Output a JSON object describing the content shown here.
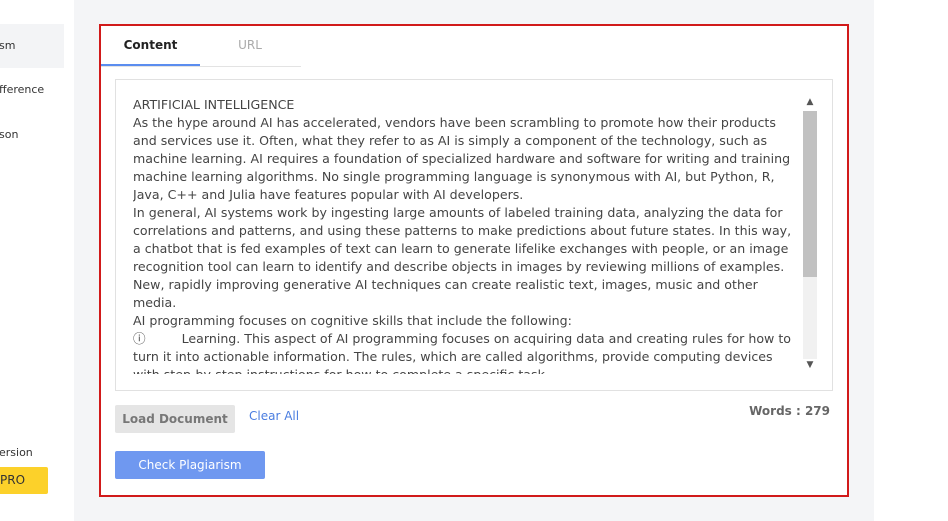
{
  "sidebar": {
    "items": [
      {
        "label": "sm"
      },
      {
        "label": "fference"
      },
      {
        "label": "son"
      }
    ],
    "footer_text": "ersion",
    "pro_label": "PRO"
  },
  "tabs": [
    {
      "label": "Content"
    },
    {
      "label": "URL"
    }
  ],
  "editor": {
    "text": "ARTIFICIAL INTELLIGENCE\nAs the hype around AI has accelerated, vendors have been scrambling to promote how their products and services use it. Often, what they refer to as AI is simply a component of the technology, such as machine learning. AI requires a foundation of specialized hardware and software for writing and training machine learning algorithms. No single programming language is synonymous with AI, but Python, R, Java, C++ and Julia have features popular with AI developers.\nIn general, AI systems work by ingesting large amounts of labeled training data, analyzing the data for correlations and patterns, and using these patterns to make predictions about future states. In this way, a chatbot that is fed examples of text can learn to generate lifelike exchanges with people, or an image recognition tool can learn to identify and describe objects in images by reviewing millions of examples. New, rapidly improving generative AI techniques can create realistic text, images, music and other media.\nAI programming focuses on cognitive skills that include the following:\nⓘ         Learning. This aspect of AI programming focuses on acquiring data and creating rules for how to turn it into actionable information. The rules, which are called algorithms, provide computing devices with step-by-step instructions for how to complete a specific task.\nⓘ         Reasoning. This aspect of AI programming focuses on choosing the right algorithm to reach a desired outcome."
  },
  "actions": {
    "load_label": "Load Document",
    "clear_label": "Clear All",
    "words_label": "Words : 279",
    "check_label": "Check Plagiarism"
  },
  "colors": {
    "panel_border": "#d11a1a",
    "tab_active_underline": "#5b8def",
    "check_button": "#6f98f0",
    "pro_button": "#fcd12a"
  }
}
